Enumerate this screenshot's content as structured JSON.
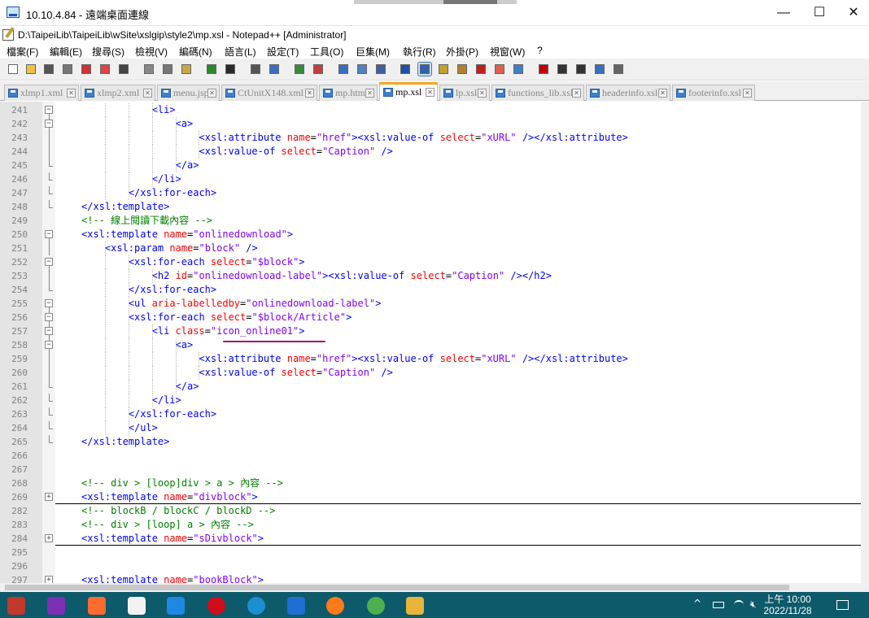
{
  "rdp": {
    "title": "10.10.4.84 - 遠端桌面連線",
    "minimize": "—",
    "maximize": "☐",
    "close": "✕"
  },
  "app": {
    "title": "D:\\TaipeiLib\\TaipeiLib\\wSite\\xslgip\\style2\\mp.xsl - Notepad++ [Administrator]",
    "minimize": "—",
    "maximize": "☐",
    "close": "✕"
  },
  "menu": [
    "檔案(F)",
    "編輯(E)",
    "搜尋(S)",
    "檢視(V)",
    "編碼(N)",
    "語言(L)",
    "設定(T)",
    "工具(O)",
    "巨集(M)",
    "執行(R)",
    "外掛(P)",
    "視窗(W)",
    "?"
  ],
  "tabs": [
    {
      "label": "xlmp1.xml",
      "active": false
    },
    {
      "label": "xlmp2.xml",
      "active": false
    },
    {
      "label": "menu.jsp",
      "active": false
    },
    {
      "label": "CtUnitX148.xml",
      "active": false
    },
    {
      "label": "mp.htm",
      "active": false
    },
    {
      "label": "mp.xsl",
      "active": true
    },
    {
      "label": "lp.xsl",
      "active": false
    },
    {
      "label": "functions_lib.xsl",
      "active": false
    },
    {
      "label": "headerinfo.xsl",
      "active": false
    },
    {
      "label": "footerinfo.xsl",
      "active": false
    }
  ],
  "code_lines": [
    {
      "n": "241",
      "fold": "box-minus",
      "indent": 4,
      "tokens": [
        [
          "t",
          "<li>"
        ]
      ]
    },
    {
      "n": "242",
      "fold": "box-minus",
      "indent": 5,
      "tokens": [
        [
          "t",
          "<a>"
        ]
      ]
    },
    {
      "n": "243",
      "fold": "line",
      "indent": 6,
      "tokens": [
        [
          "t",
          "<xsl:attribute "
        ],
        [
          "a",
          "name"
        ],
        [
          "",
          "="
        ],
        [
          "s",
          "\"href\""
        ],
        [
          "t",
          "><xsl:value-of "
        ],
        [
          "a",
          "select"
        ],
        [
          "",
          "="
        ],
        [
          "s",
          "\"xURL\""
        ],
        [
          "t",
          " /></xsl:attribute>"
        ]
      ]
    },
    {
      "n": "244",
      "fold": "line",
      "indent": 6,
      "tokens": [
        [
          "t",
          "<xsl:value-of "
        ],
        [
          "a",
          "select"
        ],
        [
          "",
          "="
        ],
        [
          "s",
          "\"Caption\""
        ],
        [
          "t",
          " />"
        ]
      ]
    },
    {
      "n": "245",
      "fold": "end",
      "indent": 5,
      "tokens": [
        [
          "t",
          "</a>"
        ]
      ]
    },
    {
      "n": "246",
      "fold": "end",
      "indent": 4,
      "tokens": [
        [
          "t",
          "</li>"
        ]
      ]
    },
    {
      "n": "247",
      "fold": "end",
      "indent": 3,
      "tokens": [
        [
          "t",
          "</xsl:for-each>"
        ]
      ]
    },
    {
      "n": "248",
      "fold": "end",
      "indent": 1,
      "tokens": [
        [
          "t",
          "</xsl:template>"
        ]
      ]
    },
    {
      "n": "249",
      "fold": "none",
      "indent": 1,
      "tokens": [
        [
          "c",
          "<!-- 線上閱讀下載內容 -->"
        ]
      ]
    },
    {
      "n": "250",
      "fold": "box-minus",
      "indent": 1,
      "tokens": [
        [
          "t",
          "<xsl:template "
        ],
        [
          "a",
          "name"
        ],
        [
          "",
          "="
        ],
        [
          "s",
          "\"onlinedownload\""
        ],
        [
          "t",
          ">"
        ]
      ]
    },
    {
      "n": "251",
      "fold": "line",
      "indent": 2,
      "tokens": [
        [
          "t",
          "<xsl:param "
        ],
        [
          "a",
          "name"
        ],
        [
          "",
          "="
        ],
        [
          "s",
          "\"block\""
        ],
        [
          "t",
          " />"
        ]
      ]
    },
    {
      "n": "252",
      "fold": "box-minus",
      "indent": 3,
      "tokens": [
        [
          "t",
          "<xsl:for-each "
        ],
        [
          "a",
          "select"
        ],
        [
          "",
          "="
        ],
        [
          "s",
          "\"$block\""
        ],
        [
          "t",
          ">"
        ]
      ]
    },
    {
      "n": "253",
      "fold": "line",
      "indent": 4,
      "tokens": [
        [
          "t",
          "<h2 "
        ],
        [
          "a",
          "id"
        ],
        [
          "",
          "="
        ],
        [
          "s",
          "\"onlinedownload-label\""
        ],
        [
          "t",
          "><xsl:value-of "
        ],
        [
          "a",
          "select"
        ],
        [
          "",
          "="
        ],
        [
          "s",
          "\"Caption\""
        ],
        [
          "t",
          " /></h2>"
        ]
      ]
    },
    {
      "n": "254",
      "fold": "end",
      "indent": 3,
      "tokens": [
        [
          "t",
          "</xsl:for-each>"
        ]
      ]
    },
    {
      "n": "255",
      "fold": "box-minus",
      "indent": 3,
      "tokens": [
        [
          "t",
          "<ul "
        ],
        [
          "a",
          "aria-labelledby"
        ],
        [
          "",
          "="
        ],
        [
          "s",
          "\"onlinedownload-label\""
        ],
        [
          "t",
          ">"
        ]
      ]
    },
    {
      "n": "256",
      "fold": "box-minus",
      "indent": 3,
      "tokens": [
        [
          "t",
          "<xsl:for-each "
        ],
        [
          "a",
          "select"
        ],
        [
          "",
          "="
        ],
        [
          "s",
          "\"$block/Article\""
        ],
        [
          "t",
          ">"
        ]
      ]
    },
    {
      "n": "257",
      "fold": "box-minus",
      "indent": 4,
      "tokens": [
        [
          "t",
          "<li "
        ],
        [
          "a",
          "class"
        ],
        [
          "",
          "="
        ],
        [
          "s",
          "\"icon_online01\""
        ],
        [
          "t",
          ">"
        ]
      ]
    },
    {
      "n": "258",
      "fold": "box-minus",
      "indent": 5,
      "tokens": [
        [
          "t",
          "<a>"
        ]
      ]
    },
    {
      "n": "259",
      "fold": "line",
      "indent": 6,
      "tokens": [
        [
          "t",
          "<xsl:attribute "
        ],
        [
          "a",
          "name"
        ],
        [
          "",
          "="
        ],
        [
          "s",
          "\"href\""
        ],
        [
          "t",
          "><xsl:value-of "
        ],
        [
          "a",
          "select"
        ],
        [
          "",
          "="
        ],
        [
          "s",
          "\"xURL\""
        ],
        [
          "t",
          " /></xsl:attribute>"
        ]
      ]
    },
    {
      "n": "260",
      "fold": "line",
      "indent": 6,
      "tokens": [
        [
          "t",
          "<xsl:value-of "
        ],
        [
          "a",
          "select"
        ],
        [
          "",
          "="
        ],
        [
          "s",
          "\"Caption\""
        ],
        [
          "t",
          " />"
        ]
      ]
    },
    {
      "n": "261",
      "fold": "end",
      "indent": 5,
      "tokens": [
        [
          "t",
          "</a>"
        ]
      ]
    },
    {
      "n": "262",
      "fold": "end",
      "indent": 4,
      "tokens": [
        [
          "t",
          "</li>"
        ]
      ]
    },
    {
      "n": "263",
      "fold": "end",
      "indent": 3,
      "tokens": [
        [
          "t",
          "</xsl:for-each>"
        ]
      ]
    },
    {
      "n": "264",
      "fold": "end",
      "indent": 3,
      "tokens": [
        [
          "t",
          "</ul>"
        ]
      ]
    },
    {
      "n": "265",
      "fold": "end",
      "indent": 1,
      "tokens": [
        [
          "t",
          "</xsl:template>"
        ]
      ]
    },
    {
      "n": "266",
      "fold": "none",
      "indent": 0,
      "tokens": []
    },
    {
      "n": "267",
      "fold": "none",
      "indent": 0,
      "tokens": []
    },
    {
      "n": "268",
      "fold": "none",
      "indent": 1,
      "tokens": [
        [
          "c",
          "<!-- div > [loop]div > a > 內容 -->"
        ]
      ]
    },
    {
      "n": "269",
      "fold": "box-plus",
      "indent": 1,
      "collapsed": true,
      "tokens": [
        [
          "t",
          "<xsl:template "
        ],
        [
          "a",
          "name"
        ],
        [
          "",
          "="
        ],
        [
          "s",
          "\"divblock\""
        ],
        [
          "t",
          ">"
        ]
      ]
    },
    {
      "n": "282",
      "fold": "none",
      "indent": 1,
      "tokens": [
        [
          "c",
          "<!-- blockB / blockC / blockD -->"
        ]
      ]
    },
    {
      "n": "283",
      "fold": "none",
      "indent": 1,
      "tokens": [
        [
          "c",
          "<!-- div > [loop] a > 內容 -->"
        ]
      ]
    },
    {
      "n": "284",
      "fold": "box-plus",
      "indent": 1,
      "collapsed": true,
      "tokens": [
        [
          "t",
          "<xsl:template "
        ],
        [
          "a",
          "name"
        ],
        [
          "",
          "="
        ],
        [
          "s",
          "\"sDivblock\""
        ],
        [
          "t",
          ">"
        ]
      ]
    },
    {
      "n": "295",
      "fold": "none",
      "indent": 0,
      "tokens": []
    },
    {
      "n": "296",
      "fold": "none",
      "indent": 0,
      "tokens": []
    },
    {
      "n": "297",
      "fold": "box-plus",
      "indent": 1,
      "tokens": [
        [
          "t",
          "<xsl:template "
        ],
        [
          "a",
          "name"
        ],
        [
          "",
          "="
        ],
        [
          "s",
          "\"bookBlock\""
        ],
        [
          "t",
          ">"
        ]
      ]
    }
  ],
  "taskbar": {
    "apps": [
      "filezilla-icon",
      "app-icon",
      "swift-icon",
      "xampp-icon",
      "vscode-icon",
      "opera-icon",
      "edge-icon",
      "ie-icon",
      "firefox-icon",
      "chrome-icon",
      "file-explorer-icon"
    ],
    "tray_chevron": "^",
    "tray_input": "A",
    "clock_time": "上午 10:00",
    "clock_date": "2022/11/28"
  },
  "colors": {
    "tag": "#0000ff",
    "attr": "#ff0000",
    "string": "#8000ff",
    "comment": "#008000",
    "highlight": "#a0146e",
    "taskbar": "#0d5a6b"
  }
}
